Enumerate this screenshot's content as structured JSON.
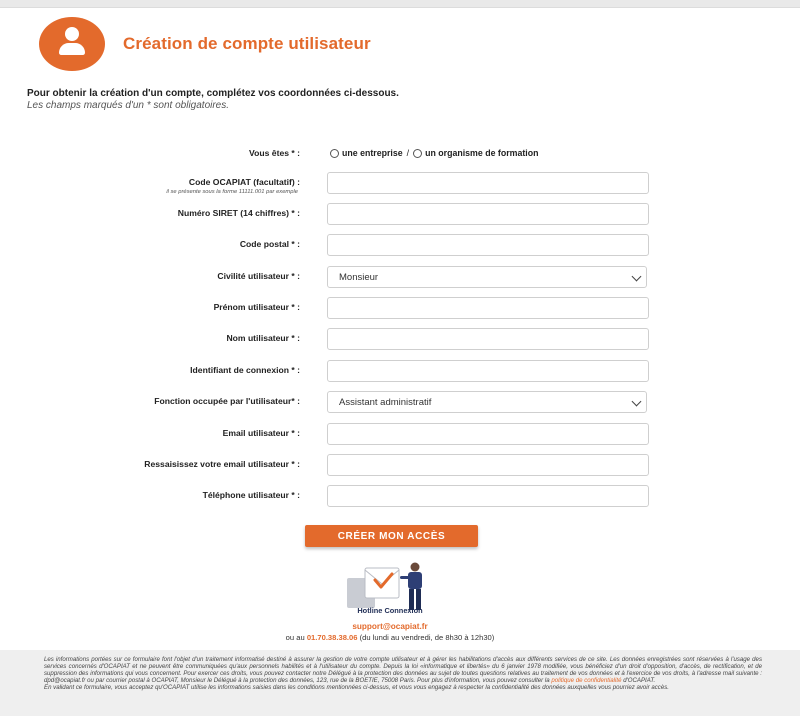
{
  "header": {
    "title": "Création de compte utilisateur"
  },
  "intro": {
    "line1": "Pour obtenir la création d'un compte, complétez vos coordonnées ci-dessous.",
    "line2": "Les champs marqués d'un * sont obligatoires."
  },
  "form": {
    "vous_etes": {
      "label": "Vous êtes * :",
      "option1": "une entreprise",
      "separator": "/",
      "option2": "un organisme de formation"
    },
    "code_ocapiat": {
      "label": "Code OCAPIAT (facultatif) :",
      "hint": "il se présente sous la forme 11111.001 par exemple",
      "value": ""
    },
    "siret": {
      "label": "Numéro SIRET (14 chiffres) * :",
      "value": ""
    },
    "code_postal": {
      "label": "Code postal * :",
      "value": ""
    },
    "civilite": {
      "label": "Civilité utilisateur * :",
      "selected": "Monsieur"
    },
    "prenom": {
      "label": "Prénom utilisateur * :",
      "value": ""
    },
    "nom": {
      "label": "Nom utilisateur * :",
      "value": ""
    },
    "identifiant": {
      "label": "Identifiant de connexion * :",
      "value": ""
    },
    "fonction": {
      "label": "Fonction occupée par l'utilisateur* :",
      "selected": "Assistant administratif"
    },
    "email": {
      "label": "Email utilisateur * :",
      "value": ""
    },
    "email_confirm": {
      "label": "Ressaisissez votre email utilisateur * :",
      "value": ""
    },
    "telephone": {
      "label": "Téléphone utilisateur * :",
      "value": ""
    },
    "submit_label": "CRÉER MON ACCÈS"
  },
  "hotline": {
    "label": "Hotline Connexion",
    "email": "support@ocapiat.fr",
    "prefix": "ou au",
    "phone": "01.70.38.38.06",
    "hours": "(du lundi au vendredi, de 8h30 à 12h30)"
  },
  "legal": {
    "text1": "Les informations portées sur ce formulaire font l'objet d'un traitement informatisé destiné à assurer la gestion de votre compte utilisateur et à gérer les habilitations d'accès aux différents services de ce site. Les données enregistrées sont réservées à l'usage des services concernés d'OCAPIAT et ne peuvent être communiquées qu'aux personnels habilités et à l'utilisateur du compte. Depuis la loi «informatique et libertés» du 6 janvier 1978 modifiée, vous bénéficiez d'un droit d'opposition, d'accès, de rectification, et de suppression des informations qui vous concernent. Pour exercer ces droits, vous pouvez contacter notre Délégué à la protection des données au sujet de toutes questions relatives au traitement de vos données et à l'exercice de vos droits, à l'adresse mail suivante : dpd@ocapiat.fr ou par courrier postal à OCAPIAT, Monsieur le Délégué à la protection des données, 123, rue de la BOETIE, 75008 Paris. Pour plus d'information, vous pouvez consulter la",
    "link": "politique de confidentialité",
    "text2": "d'OCAPIAT.",
    "text3": "En validant ce formulaire, vous acceptez qu'OCAPIAT utilise les informations saisies dans les conditions mentionnées ci-dessus, et vous vous engagez à respecter la confidentialité des données auxquelles vous pourriez avoir accès."
  },
  "colors": {
    "accent": "#e36a2c",
    "navy": "#1f2d55"
  }
}
